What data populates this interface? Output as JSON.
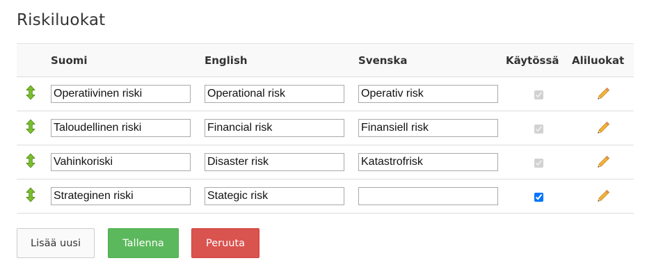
{
  "page": {
    "title": "Riskiluokat"
  },
  "table": {
    "headers": {
      "finnish": "Suomi",
      "english": "English",
      "swedish": "Svenska",
      "active": "Käytössä",
      "subclasses": "Aliluokat"
    },
    "rows": [
      {
        "finnish": "Operatiivinen riski",
        "english": "Operational risk",
        "swedish": "Operativ risk",
        "active": true,
        "active_disabled": true
      },
      {
        "finnish": "Taloudellinen riski",
        "english": "Financial risk",
        "swedish": "Finansiell risk",
        "active": true,
        "active_disabled": true
      },
      {
        "finnish": "Vahinkoriski",
        "english": "Disaster risk",
        "swedish": "Katastrofrisk",
        "active": true,
        "active_disabled": true
      },
      {
        "finnish": "Strateginen riski",
        "english": "Stategic risk",
        "swedish": "",
        "active": true,
        "active_disabled": false
      }
    ]
  },
  "icons": {
    "drag": "drag-handle-icon",
    "edit": "pencil-icon"
  },
  "buttons": {
    "add_new": "Lisää uusi",
    "save": "Tallenna",
    "cancel": "Peruuta"
  },
  "colors": {
    "save": "#5cb85c",
    "cancel": "#d9534f",
    "drag_icon": "#77b82a",
    "pencil": "#f0a830"
  }
}
